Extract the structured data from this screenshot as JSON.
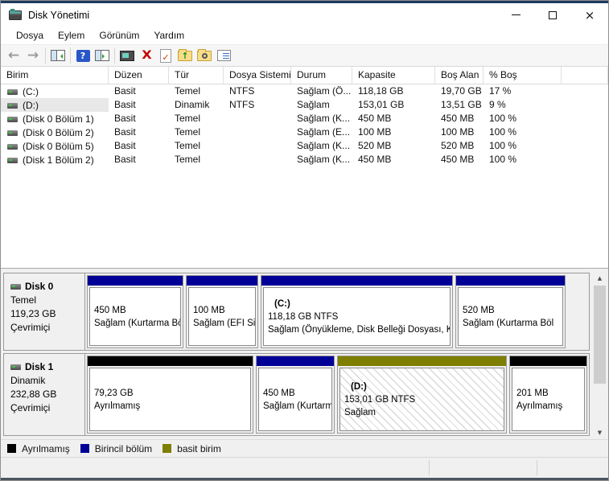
{
  "window": {
    "title": "Disk Yönetimi",
    "controls": {
      "minimize": "minimize",
      "maximize": "maximize",
      "close": "×"
    }
  },
  "menu": {
    "items": [
      {
        "label": "Dosya"
      },
      {
        "label": "Eylem"
      },
      {
        "label": "Görünüm"
      },
      {
        "label": "Yardım"
      }
    ]
  },
  "toolbar": {
    "icons": [
      "back-arrow",
      "forward-arrow",
      "console-tree",
      "help",
      "export-list",
      "properties",
      "delete",
      "action-check",
      "folder-up",
      "folder-search",
      "task-list"
    ],
    "back_glyph": "←",
    "forward_glyph": "→",
    "help_glyph": "?",
    "delete_glyph": "X",
    "check_glyph": "✓",
    "up_glyph": "↑"
  },
  "volume_table": {
    "columns": [
      "Birim",
      "Düzen",
      "Tür",
      "Dosya Sistemi",
      "Durum",
      "Kapasite",
      "Boş Alan",
      "% Boş"
    ],
    "rows": [
      {
        "name": "(C:)",
        "layout": "Basit",
        "type": "Temel",
        "fs": "NTFS",
        "status": "Sağlam (Ö...",
        "capacity": "118,18 GB",
        "free": "19,70 GB",
        "pct": "17 %"
      },
      {
        "name": "(D:)",
        "layout": "Basit",
        "type": "Dinamik",
        "fs": "NTFS",
        "status": "Sağlam",
        "capacity": "153,01 GB",
        "free": "13,51 GB",
        "pct": "9 %"
      },
      {
        "name": "(Disk 0 Bölüm 1)",
        "layout": "Basit",
        "type": "Temel",
        "fs": "",
        "status": "Sağlam (K...",
        "capacity": "450 MB",
        "free": "450 MB",
        "pct": "100 %"
      },
      {
        "name": "(Disk 0 Bölüm 2)",
        "layout": "Basit",
        "type": "Temel",
        "fs": "",
        "status": "Sağlam (E...",
        "capacity": "100 MB",
        "free": "100 MB",
        "pct": "100 %"
      },
      {
        "name": "(Disk 0 Bölüm 5)",
        "layout": "Basit",
        "type": "Temel",
        "fs": "",
        "status": "Sağlam (K...",
        "capacity": "520 MB",
        "free": "520 MB",
        "pct": "100 %"
      },
      {
        "name": "(Disk 1 Bölüm 2)",
        "layout": "Basit",
        "type": "Temel",
        "fs": "",
        "status": "Sağlam (K...",
        "capacity": "450 MB",
        "free": "450 MB",
        "pct": "100 %"
      }
    ]
  },
  "disks": [
    {
      "name": "Disk 0",
      "type": "Temel",
      "size": "119,23 GB",
      "status": "Çevrimiçi",
      "partitions": [
        {
          "line2": "450 MB",
          "line3": "Sağlam (Kurtarma Bö",
          "color": "#000096"
        },
        {
          "line2": "100 MB",
          "line3": "Sağlam (EFI Sis",
          "color": "#000096"
        },
        {
          "line1": "(C:)",
          "line2": "118,18 GB NTFS",
          "line3": "Sağlam (Önyükleme, Disk Belleği Dosyası, K",
          "color": "#000096"
        },
        {
          "line2": "520 MB",
          "line3": "Sağlam (Kurtarma Böl",
          "color": "#000096"
        }
      ]
    },
    {
      "name": "Disk 1",
      "type": "Dinamik",
      "size": "232,88 GB",
      "status": "Çevrimiçi",
      "partitions": [
        {
          "line2": "79,23 GB",
          "line3": "Ayrılmamış",
          "color": "#000000"
        },
        {
          "line2": "450 MB",
          "line3": "Sağlam (Kurtarma",
          "color": "#000096"
        },
        {
          "line1": "(D:)",
          "line2": "153,01 GB NTFS",
          "line3": "Sağlam",
          "color": "#7e7e00"
        },
        {
          "line2": "201 MB",
          "line3": "Ayrılmamış",
          "color": "#000000"
        }
      ]
    }
  ],
  "legend": {
    "items": [
      {
        "label": "Ayrılmamış",
        "color": "#000000"
      },
      {
        "label": "Birincil bölüm",
        "color": "#000096"
      },
      {
        "label": "basit birim",
        "color": "#7e7e00"
      }
    ]
  },
  "colors": {
    "frame_accent": "#1c3a5e",
    "primary_partition": "#000096",
    "simple_volume": "#7e7e00",
    "unallocated": "#000000"
  }
}
